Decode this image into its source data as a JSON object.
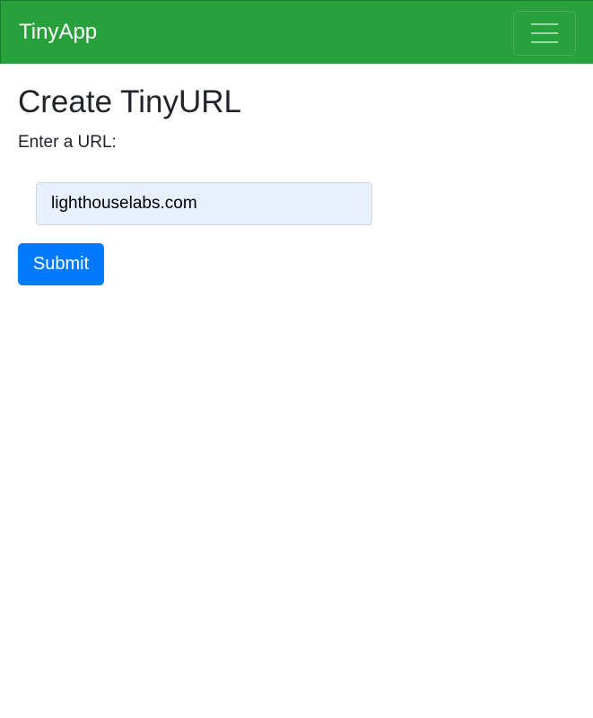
{
  "navbar": {
    "brand": "TinyApp",
    "toggler_icon": "hamburger-menu-icon",
    "color": "#28a03c"
  },
  "main": {
    "title": "Create TinyURL",
    "prompt": "Enter a URL:",
    "url_input": {
      "value": "lighthouselabs.com",
      "background": "#e8f0fe"
    },
    "submit_label": "Submit",
    "submit_color": "#007bff"
  }
}
